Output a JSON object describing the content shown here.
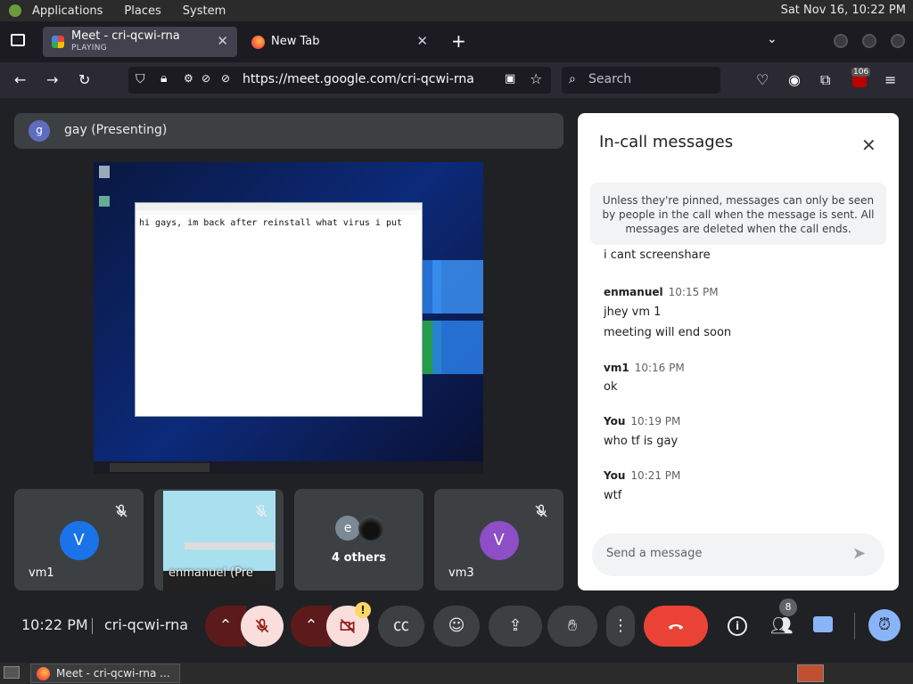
{
  "system_panel": {
    "menus": [
      "Applications",
      "Places",
      "System"
    ],
    "clock": "Sat Nov 16, 10:22 PM"
  },
  "browser": {
    "tabs": [
      {
        "title": "Meet - cri-qcwi-rna",
        "subtitle": "PLAYING"
      },
      {
        "title": "New Tab"
      }
    ],
    "url": "https://meet.google.com/cri-qcwi-rna",
    "search_placeholder": "Search",
    "extension_badge": "106"
  },
  "meet": {
    "presenter": {
      "avatar_letter": "g",
      "label": "gay (Presenting)"
    },
    "shared_screen_text": "hi gays, im back after reinstall what virus i put",
    "tiles": [
      {
        "name": "vm1",
        "avatar_letter": "V",
        "avatar_color": "#1a73e8"
      },
      {
        "name": "enmanuel (Pre"
      },
      {
        "name": "4 others",
        "avatar_letter": "e"
      },
      {
        "name": "vm3",
        "avatar_letter": "V",
        "avatar_color": "#8e4ec6"
      }
    ],
    "chat": {
      "title": "In-call messages",
      "notice": "Unless they're pinned, messages can only be seen by people in the call when the message is sent. All messages are deleted when the call ends.",
      "partial_message": "i cant screenshare",
      "groups": [
        {
          "sender": "enmanuel",
          "time": "10:15 PM",
          "messages": [
            "jhey vm 1",
            "meeting will end soon"
          ]
        },
        {
          "sender": "vm1",
          "time": "10:16 PM",
          "messages": [
            "ok"
          ]
        },
        {
          "sender": "You",
          "time": "10:19 PM",
          "messages": [
            "who tf is gay"
          ]
        },
        {
          "sender": "You",
          "time": "10:21 PM",
          "messages": [
            "wtf"
          ]
        }
      ],
      "input_placeholder": "Send a message"
    },
    "bottom_bar": {
      "time": "10:22 PM",
      "meeting_code": "cri-qcwi-rna",
      "people_count": "8"
    }
  },
  "os_taskbar": {
    "window_label": "Meet - cri-qcwi-rna ..."
  }
}
